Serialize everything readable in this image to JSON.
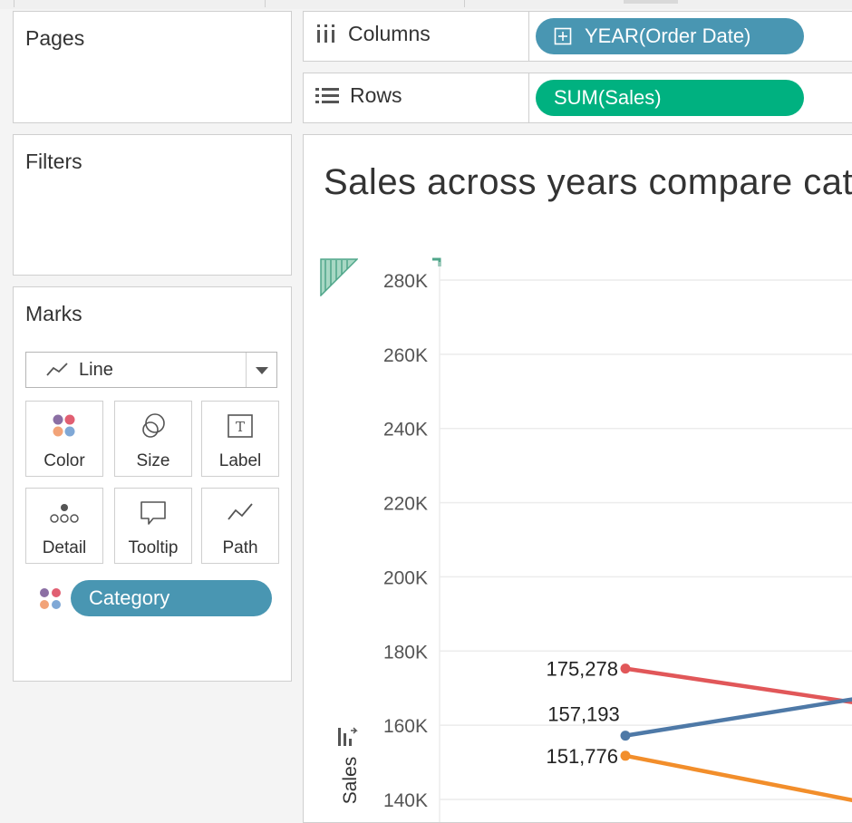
{
  "pages": {
    "title": "Pages"
  },
  "filters": {
    "title": "Filters"
  },
  "marks": {
    "title": "Marks",
    "mark_type": "Line",
    "buttons": [
      "Color",
      "Size",
      "Label",
      "Detail",
      "Tooltip",
      "Path"
    ],
    "field_pill": "Category"
  },
  "shelves": {
    "columns_label": "Columns",
    "columns_pill": "YEAR(Order Date)",
    "rows_label": "Rows",
    "rows_pill": "SUM(Sales)"
  },
  "viz": {
    "title": "Sales across years compare cat"
  },
  "colors": {
    "blue_pill": "#4996b2",
    "green_pill": "#00b180",
    "series_red": "#e15759",
    "series_blue": "#4e79a7",
    "series_orange": "#f28e2b"
  },
  "icons": [
    "columns-icon",
    "rows-icon",
    "line-mark-icon",
    "chevron-down-icon",
    "color-icon",
    "size-icon",
    "label-icon",
    "detail-icon",
    "tooltip-icon",
    "path-icon",
    "sort-icon"
  ],
  "chart_data": {
    "type": "line",
    "title": "Sales across years compare cat",
    "ylabel": "Sales",
    "ylim": [
      140000,
      280000
    ],
    "y_ticks": [
      "140K",
      "160K",
      "180K",
      "200K",
      "220K",
      "240K",
      "260K",
      "280K"
    ],
    "grid": true,
    "series": [
      {
        "color": "#e15759",
        "values": [
          175278
        ],
        "data_labels": [
          "175,278"
        ]
      },
      {
        "color": "#4e79a7",
        "values": [
          157193
        ],
        "data_labels": [
          "157,193"
        ]
      },
      {
        "color": "#f28e2b",
        "values": [
          151776
        ],
        "data_labels": [
          "151,776"
        ]
      }
    ]
  }
}
